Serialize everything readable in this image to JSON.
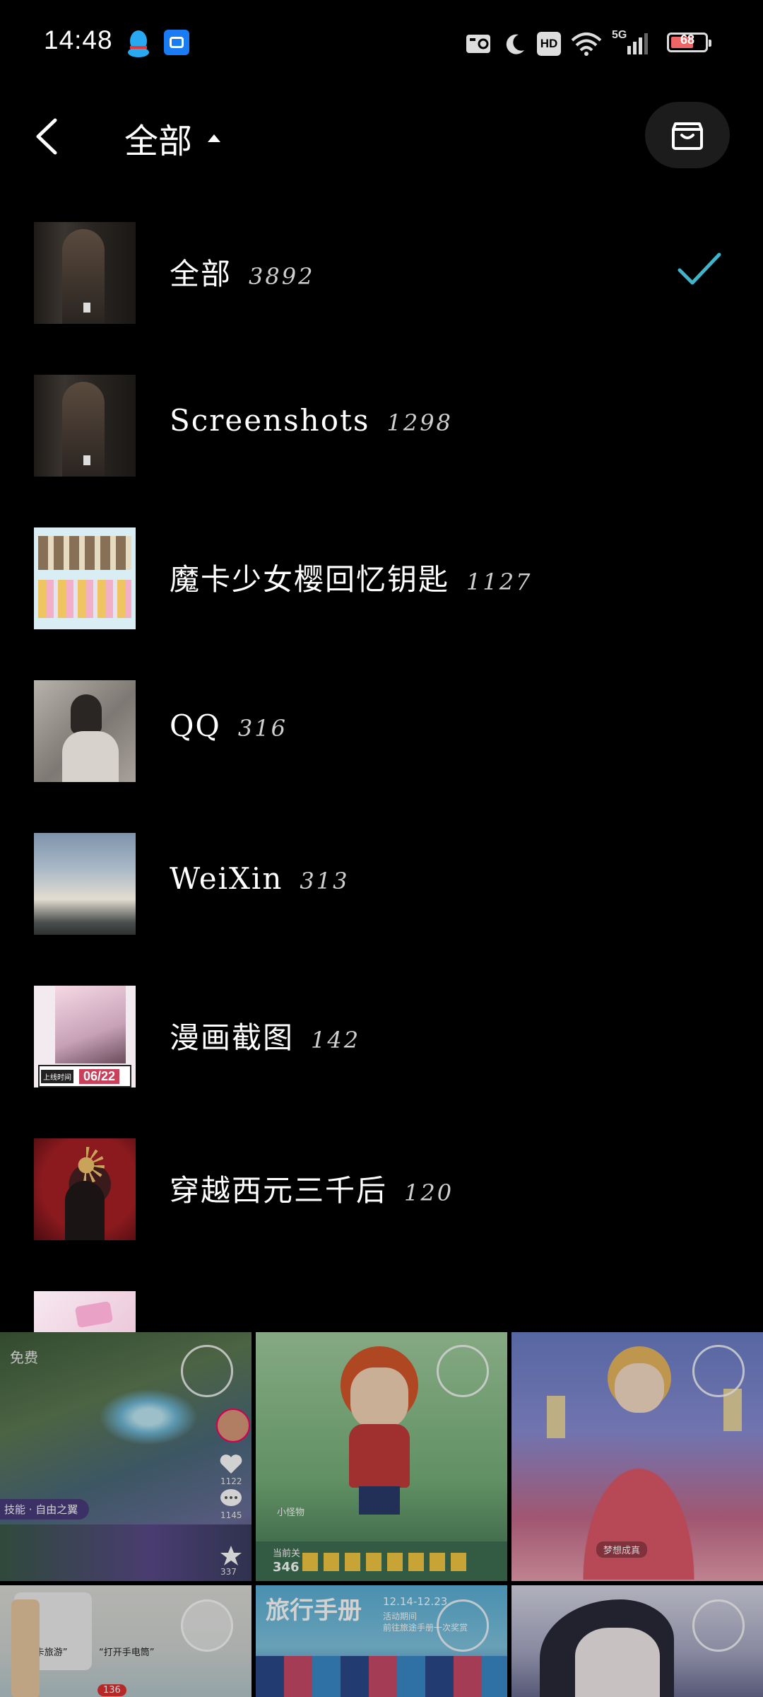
{
  "status_bar": {
    "time": "14:48",
    "hd_label": "HD",
    "network_label": "5G",
    "battery_level": "68",
    "battery_fraction": 0.68
  },
  "header": {
    "title": "全部"
  },
  "albums": [
    {
      "name": "全部",
      "count": "3892",
      "selected": true
    },
    {
      "name": "Screenshots",
      "count": "1298",
      "selected": false
    },
    {
      "name": "魔卡少女樱回忆钥匙",
      "count": "1127",
      "selected": false
    },
    {
      "name": "QQ",
      "count": "316",
      "selected": false
    },
    {
      "name": "WeiXin",
      "count": "313",
      "selected": false
    },
    {
      "name": "漫画截图",
      "count": "142",
      "selected": false
    },
    {
      "name": "穿越西元三千后",
      "count": "120",
      "selected": false
    }
  ],
  "grid_thumbs": {
    "game_label_free": "免费",
    "game_label_tag": "技能 · 自由之翼",
    "game_stats": [
      "1122",
      "1145",
      "337"
    ],
    "stage_label": "当前关",
    "stage_number": "346",
    "store_label": "小怪物",
    "booklet_title": "旅行手册",
    "booklet_date": "12.14-12.23",
    "booklet_sub": "活动期间\n前往旅途手册一次奖赏",
    "poster_caption": "梦想成真",
    "manga_date": "06/22",
    "manga_label": "上线时间",
    "note_a": "“打卡旅游”",
    "note_b": "“打开手电筒”",
    "note_badge": "136"
  },
  "colors": {
    "background": "#000000",
    "accent_check": "#3fb5c9",
    "cart_button_bg": "#1c1c1c"
  }
}
